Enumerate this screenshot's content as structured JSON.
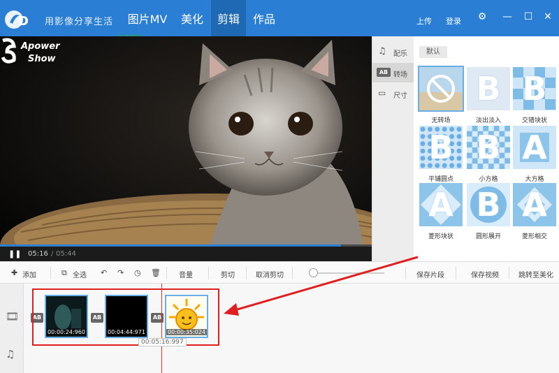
{
  "app": {
    "title": "用影像分享生活",
    "logo_text": "iD"
  },
  "nav": {
    "tabs": [
      "图片MV",
      "美化",
      "剪辑",
      "作品"
    ],
    "active_index": 2
  },
  "header": {
    "upload": "上传",
    "login": "登录"
  },
  "watermark": "www.pc0359.cn",
  "player": {
    "brand_line1": "Apower",
    "brand_line2": "Show",
    "current_time": "05:16",
    "separator": "/",
    "total_time": "05:44",
    "progress_fraction": 0.918
  },
  "side_tabs": [
    {
      "icon": "music-icon",
      "label": "配乐"
    },
    {
      "icon": "transition-icon",
      "label": "转场"
    },
    {
      "icon": "size-icon",
      "label": "尺寸"
    }
  ],
  "transitions": {
    "category": "默认",
    "tiles": [
      {
        "label": "无转场",
        "style": "none",
        "selected": true
      },
      {
        "label": "淡出淡入",
        "style": "fade"
      },
      {
        "label": "交错块状",
        "style": "stagger"
      },
      {
        "label": "平铺圆点",
        "style": "dots"
      },
      {
        "label": "小方格",
        "style": "grid"
      },
      {
        "label": "大方格",
        "style": "bigsquare"
      },
      {
        "label": "菱形块状",
        "style": "diamond"
      },
      {
        "label": "圆形展开",
        "style": "circle"
      },
      {
        "label": "菱形相交",
        "style": "diamond2"
      }
    ]
  },
  "toolbar": {
    "add": "添加",
    "select_all": "全选",
    "volume": "音量",
    "cut": "剪切",
    "cancel_cut": "取消剪切",
    "save_clip": "保存片段",
    "save_video": "保存视频",
    "go_beautify": "跳转至美化"
  },
  "timeline": {
    "clips": [
      {
        "time": "00:00:24:960",
        "thumb": "dark-scene"
      },
      {
        "time": "00:04:44:971",
        "thumb": "black"
      },
      {
        "time": "00:00:35:024",
        "thumb": "sun"
      }
    ],
    "transition_badge": "AB",
    "playhead_time": "00:05:16:997"
  },
  "colors": {
    "accent": "#2a7fd4",
    "highlight": "#e02020"
  }
}
